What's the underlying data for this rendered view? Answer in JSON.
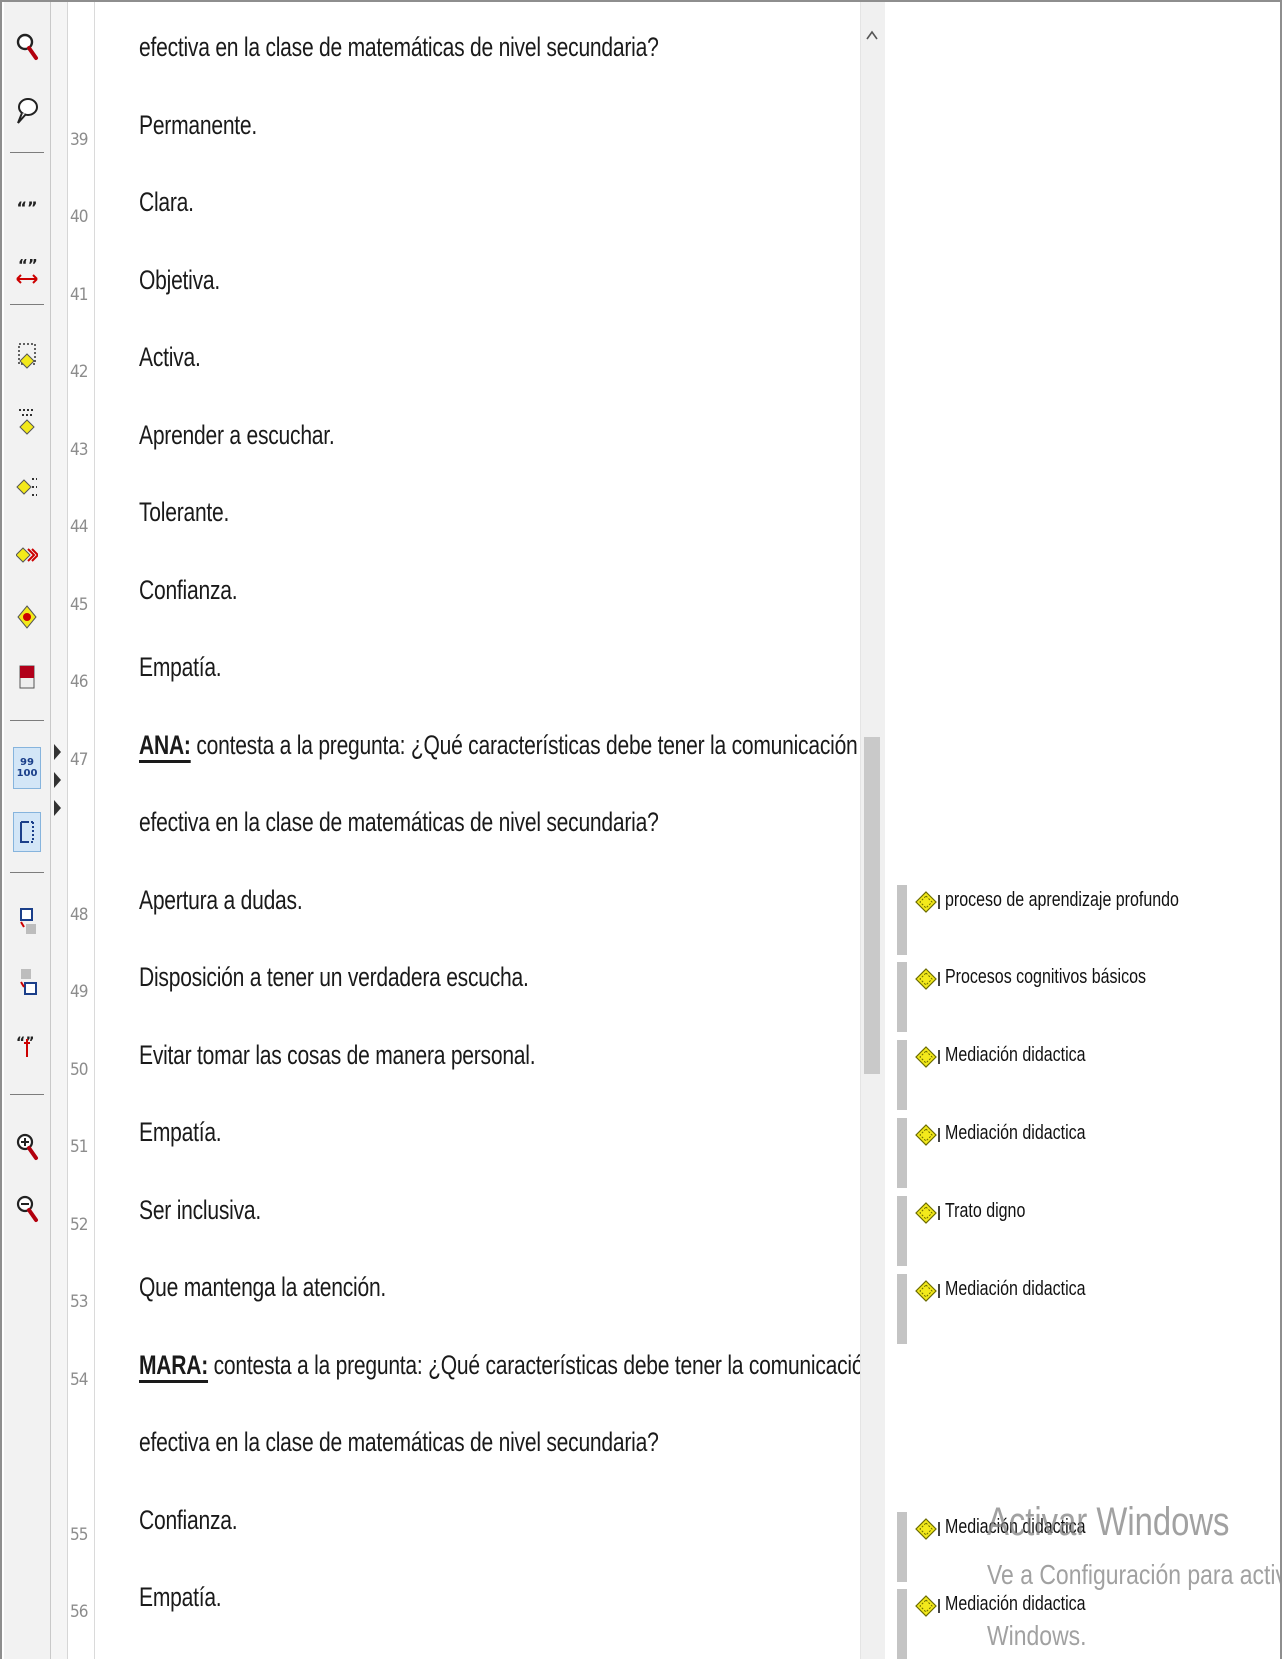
{
  "toolbar": {
    "tools": [
      "search-icon",
      "comment-icon",
      "quote-icon",
      "quote-link-icon",
      "code-list-icon",
      "code-filter-icon",
      "code-partial-icon",
      "code-arrows-icon",
      "code-star-icon",
      "memo-icon",
      "line-numbers-icon",
      "layout-icon",
      "move-code-up-icon",
      "move-code-down-icon",
      "quote-edit-icon",
      "zoom-in-icon",
      "zoom-out-icon"
    ],
    "line_numbers_label_top": "99",
    "line_numbers_label_bottom": "100"
  },
  "line_numbers": [
    "39",
    "40",
    "41",
    "42",
    "43",
    "44",
    "45",
    "46",
    "47",
    "48",
    "49",
    "50",
    "51",
    "52",
    "53",
    "54",
    "55",
    "56"
  ],
  "document": {
    "lines": [
      {
        "text": "efectiva en la clase de matemáticas de nivel secundaria?"
      },
      {
        "text": "Permanente."
      },
      {
        "text": "Clara."
      },
      {
        "text": "Objetiva."
      },
      {
        "text": "Activa."
      },
      {
        "text": "Aprender a escuchar."
      },
      {
        "text": "Tolerante."
      },
      {
        "text": "Confianza."
      },
      {
        "text": "Empatía."
      },
      {
        "speaker": "ANA:",
        "text": " contesta a la pregunta: ¿Qué características  debe tener la comunicación"
      },
      {
        "text": "efectiva en la clase de matemáticas de nivel secundaria?"
      },
      {
        "text": "Apertura a dudas."
      },
      {
        "text": "Disposición a tener un verdadera escucha."
      },
      {
        "text": "Evitar tomar las cosas de manera personal."
      },
      {
        "text": "Empatía."
      },
      {
        "text": "Ser inclusiva."
      },
      {
        "text": "Que mantenga la atención."
      },
      {
        "speaker": "MARA:",
        "text": " contesta a la pregunta: ¿Qué características  debe tener la comunicación"
      },
      {
        "text": "efectiva en la clase de matemáticas de nivel secundaria?"
      },
      {
        "text": "Confianza."
      },
      {
        "text": "Empatía."
      }
    ]
  },
  "codes": [
    {
      "label": "proceso de aprendizaje profundo"
    },
    {
      "label": "Procesos cognitivos básicos"
    },
    {
      "label": "Mediación didactica"
    },
    {
      "label": "Mediación didactica"
    },
    {
      "label": "Trato digno"
    },
    {
      "label": "Mediación didactica"
    },
    {
      "label": "Mediación didactica"
    },
    {
      "label": "Mediación didactica"
    }
  ],
  "watermark": {
    "title": "Activar Windows",
    "subtitle": "Ve a Configuración para activar",
    "subtitle2": "Windows."
  },
  "colors": {
    "code_icon": "#f3e91b",
    "code_bar": "#c4c4c4"
  }
}
